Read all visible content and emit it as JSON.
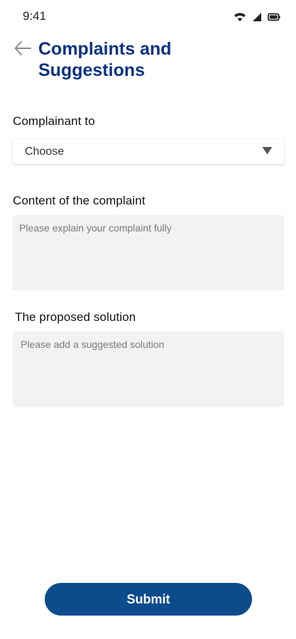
{
  "status_bar": {
    "time": "9:41"
  },
  "header": {
    "title": "Complaints and Suggestions"
  },
  "form": {
    "complainant_label": "Complainant to",
    "complainant_select_value": "Choose",
    "content_label": "Content of the complaint",
    "content_placeholder": "Please explain your complaint fully",
    "solution_label": "The proposed solution",
    "solution_placeholder": "Please add a suggested solution",
    "submit_label": "Submit"
  },
  "colors": {
    "title": "#0d3283",
    "submit_button": "#0c4b8c",
    "textarea_background": "#f2f2f2"
  },
  "icons": [
    "wifi-icon",
    "cellular-signal-icon",
    "battery-icon",
    "back-arrow-icon",
    "dropdown-arrow-icon"
  ]
}
